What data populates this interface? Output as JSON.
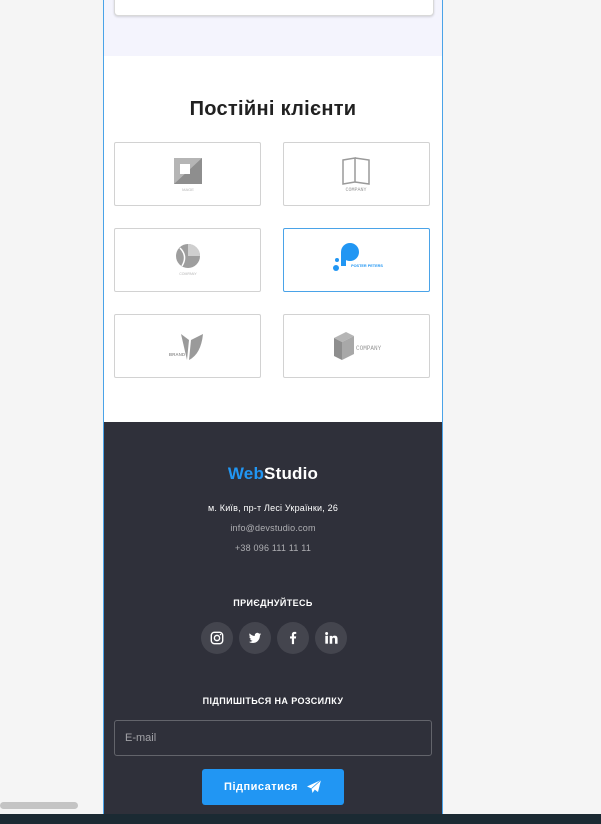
{
  "clients": {
    "title": "Постійні клієнти",
    "logos": [
      {
        "icon": "square-logo-icon",
        "caption": "MAGE"
      },
      {
        "icon": "book-logo-icon",
        "caption": "COMPANY"
      },
      {
        "icon": "shell-logo-icon",
        "caption": "COMPANY"
      },
      {
        "icon": "poster-peters-logo-icon",
        "caption": "POSTER PETERS"
      },
      {
        "icon": "leaf-brand-logo-icon",
        "caption": "BRAND"
      },
      {
        "icon": "box-company-logo-icon",
        "caption": "COMPANY"
      }
    ]
  },
  "footer": {
    "brand_part1": "Web",
    "brand_part2": "Studio",
    "address": "м. Київ, пр-т Лесі Українки, 26",
    "email": "info@devstudio.com",
    "phone": "+38 096 111 11 11",
    "join_label": "ПРИЄДНУЙТЕСЬ",
    "socials": [
      "instagram-icon",
      "twitter-icon",
      "facebook-icon",
      "linkedin-icon"
    ],
    "subscribe_label": "ПІДПИШІТЬСЯ НА РОЗСИЛКУ",
    "email_placeholder": "E-mail",
    "subscribe_button": "Підписатися"
  },
  "colors": {
    "accent": "#2196f3",
    "footer_bg": "#2f303a",
    "frame_border": "#4aa3e8"
  }
}
